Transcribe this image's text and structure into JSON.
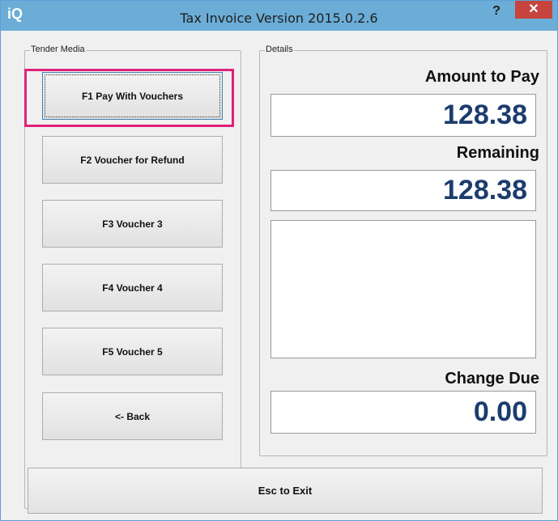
{
  "window": {
    "app_icon_text": "iQ",
    "title": "Tax Invoice Version 2015.0.2.6",
    "help_label": "?",
    "close_label": "✕"
  },
  "tender_media": {
    "legend": "Tender Media",
    "buttons": [
      {
        "label": "F1 Pay With Vouchers"
      },
      {
        "label": "F2 Voucher for Refund"
      },
      {
        "label": "F3 Voucher 3"
      },
      {
        "label": "F4 Voucher 4"
      },
      {
        "label": "F5 Voucher 5"
      },
      {
        "label": "<- Back"
      }
    ]
  },
  "details": {
    "legend": "Details",
    "amount_to_pay_label": "Amount to Pay",
    "amount_to_pay_value": "128.38",
    "remaining_label": "Remaining",
    "remaining_value": "128.38",
    "change_due_label": "Change Due",
    "change_due_value": "0.00"
  },
  "footer": {
    "esc_label": "Esc to Exit"
  },
  "colors": {
    "titlebar": "#6badd7",
    "close_button": "#c7443e",
    "highlight": "#e0207a",
    "value_text": "#1c3c6e"
  }
}
